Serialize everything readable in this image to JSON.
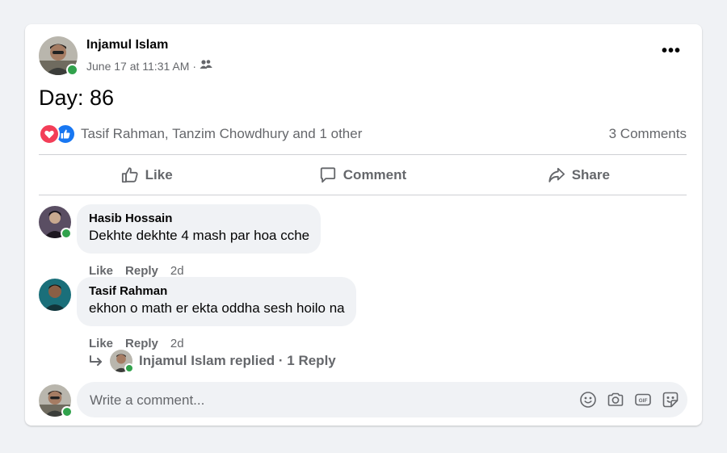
{
  "post": {
    "author": "Injamul Islam",
    "timestamp": "June 17 at 11:31 AM",
    "separator": "·",
    "privacy_icon": "friends-icon",
    "more_icon": "more-options-icon",
    "more_label": "•••",
    "text": "Day: 86"
  },
  "reactions": {
    "icons": [
      "love-reaction-icon",
      "like-reaction-icon"
    ],
    "text": "Tasif Rahman, Tanzim Chowdhury and 1 other",
    "comments_count": "3 Comments"
  },
  "actions": {
    "like": "Like",
    "comment": "Comment",
    "share": "Share"
  },
  "comments": [
    {
      "name": "Hasib Hossain",
      "text": "Dekhte dekhte 4 mash par hoa cche",
      "like": "Like",
      "reply": "Reply",
      "time": "2d"
    },
    {
      "name": "Tasif Rahman",
      "text": "ekhon o math er ekta oddha sesh hoilo na",
      "like": "Like",
      "reply": "Reply",
      "time": "2d"
    }
  ],
  "replies": {
    "text": "Injamul Islam replied · 1 Reply",
    "icon": "reply-arrow-icon"
  },
  "composer": {
    "placeholder": "Write a comment...",
    "icons": [
      "emoji-icon",
      "camera-icon",
      "gif-icon",
      "sticker-icon"
    ]
  },
  "colors": {
    "online": "#31a24c",
    "love": "#f33e58",
    "like": "#1877f2",
    "muted": "#65676b"
  }
}
